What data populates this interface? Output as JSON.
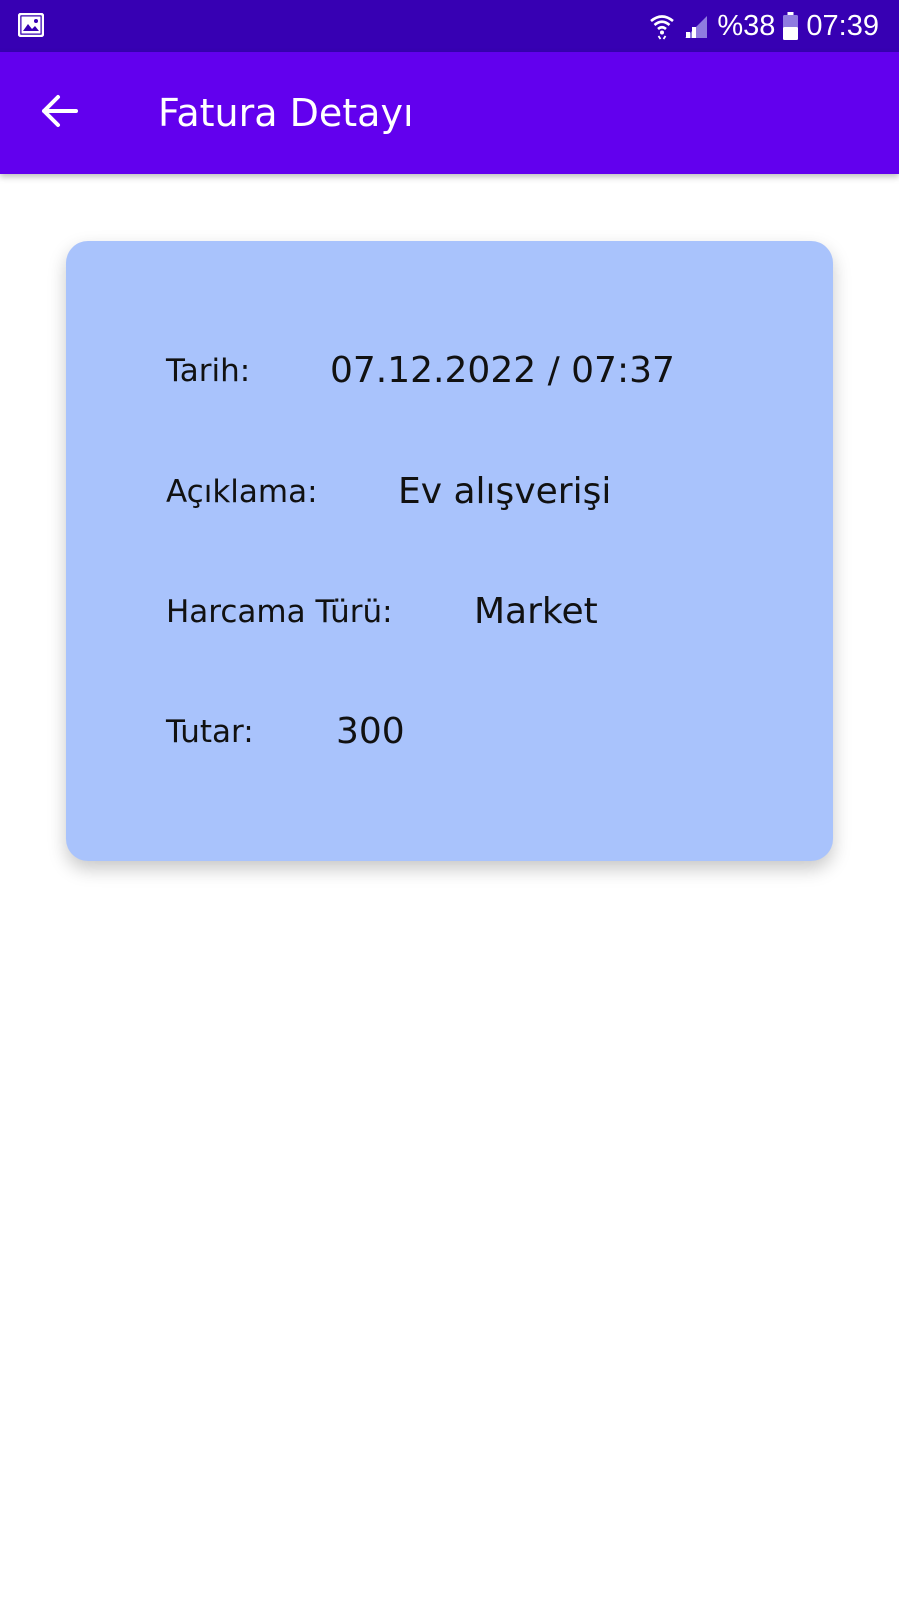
{
  "status_bar": {
    "battery_percent": "%38",
    "time": "07:39",
    "icons": [
      "image-notification-icon",
      "wifi-icon",
      "signal-icon",
      "battery-icon"
    ]
  },
  "app_bar": {
    "title": "Fatura Detayı",
    "back_icon": "arrow-back-icon",
    "color": "#6200EE"
  },
  "card": {
    "background": "#A9C3FC",
    "rows": [
      {
        "label": "Tarih:",
        "value": "07.12.2022 / 07:37"
      },
      {
        "label": "Açıklama:",
        "value": "Ev alışverişi"
      },
      {
        "label": "Harcama Türü:",
        "value": "Market"
      },
      {
        "label": "Tutar:",
        "value": "300"
      }
    ]
  }
}
